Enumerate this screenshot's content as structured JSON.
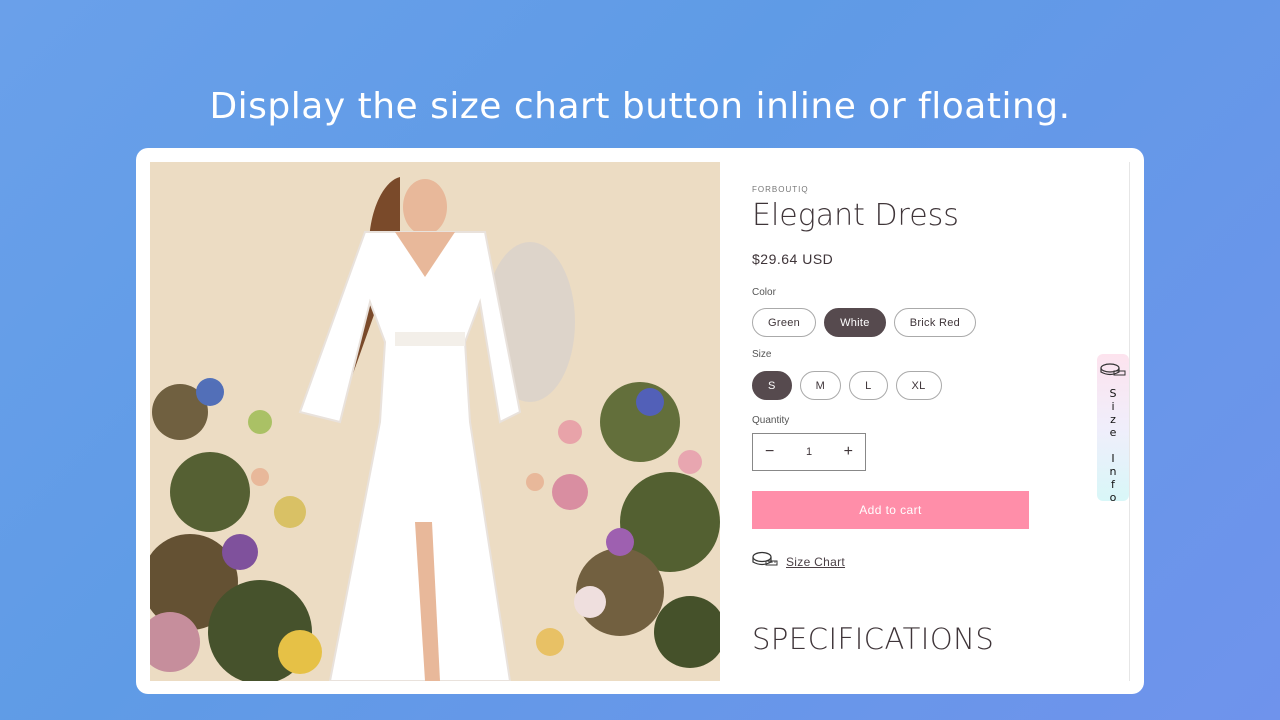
{
  "headline": "Display the size chart button inline or floating.",
  "product": {
    "vendor": "FORBOUTIQ",
    "title": "Elegant Dress",
    "price": "$29.64 USD"
  },
  "color_option": {
    "label": "Color",
    "values": [
      "Green",
      "White",
      "Brick Red"
    ],
    "selected": "White"
  },
  "size_option": {
    "label": "Size",
    "values": [
      "S",
      "M",
      "L",
      "XL"
    ],
    "selected": "S"
  },
  "quantity": {
    "label": "Quantity",
    "value": "1",
    "minus": "−",
    "plus": "+"
  },
  "add_to_cart": "Add to cart",
  "size_chart_link": "Size Chart",
  "specifications_heading": "SPECIFICATIONS",
  "floating_button": {
    "label": "S\ni\nz\ne\n \nI\nn\nf\no"
  },
  "colors": {
    "accent_pink": "#ff8ea9",
    "selected_pill": "#564a4e",
    "text_dark": "#3f3539"
  }
}
